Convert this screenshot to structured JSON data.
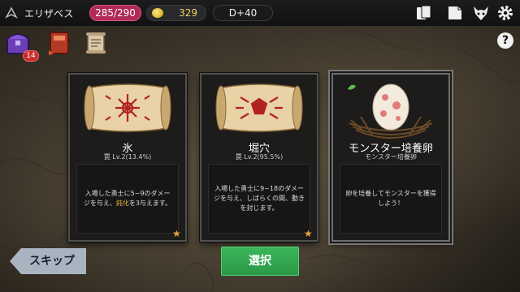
{
  "player": {
    "name": "エリザベス",
    "hp": "285/290",
    "gold": "329",
    "depth": "D+40"
  },
  "inventory": {
    "badge_count": "14"
  },
  "help_label": "?",
  "cards": [
    {
      "name": "氷",
      "sub": "罠 Lv.2(13.4%)",
      "desc_pre": "入場した勇士に5~9のダメージを与え、",
      "desc_highlight": "鈍化",
      "desc_post": "を3与えます。",
      "star": "★"
    },
    {
      "name": "堀穴",
      "sub": "罠 Lv.2(95.5%)",
      "desc": "入場した勇士に9~18のダメージを与え、しばらくの間、動きを封じます。",
      "star": "★"
    },
    {
      "name": "モンスター培養卵",
      "sub": "モンスター培養卵",
      "desc": "卵を培養してモンスターを獲得しよう！"
    }
  ],
  "buttons": {
    "skip": "スキップ",
    "select": "選択"
  },
  "colors": {
    "hp": "#b12a56",
    "select": "#2fa64d",
    "skip": "#a9b4c0",
    "highlight": "#e6b73a"
  }
}
